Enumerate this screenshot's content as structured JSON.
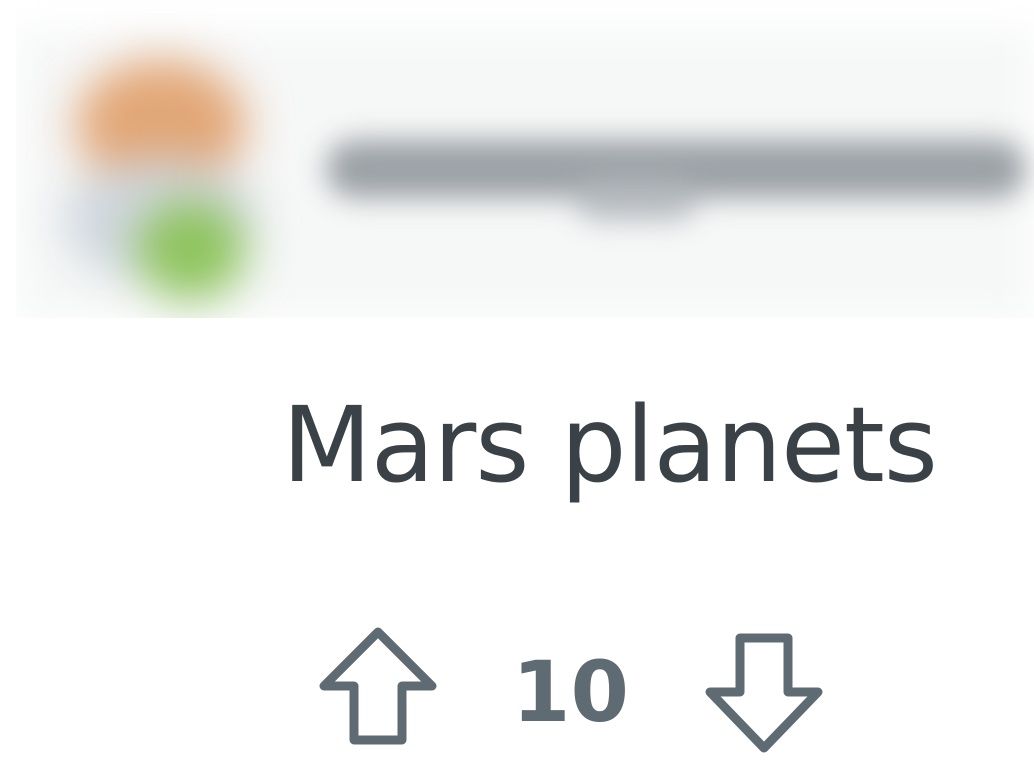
{
  "post": {
    "title": "Mars planets",
    "author": {
      "username": "",
      "avatar_icon": "user-avatar-icon",
      "blurred": true
    }
  },
  "votes": {
    "count": "10",
    "upvote_icon": "arrow-up-outline-icon",
    "downvote_icon": "arrow-down-outline-icon"
  },
  "colors": {
    "background": "#ffffff",
    "title": "#3a4247",
    "vote_count": "#5f6b73",
    "icon_stroke": "#5f6b73"
  }
}
